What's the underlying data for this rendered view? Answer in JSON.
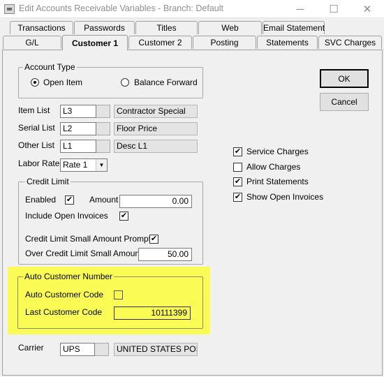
{
  "window": {
    "title": "Edit Accounts Receivable Variables  - Branch: Default",
    "minimize": "─",
    "maximize": "☐",
    "close": "✕"
  },
  "tabs": {
    "row_top": [
      "Transactions",
      "Passwords",
      "Titles",
      "Web",
      "Email Statement"
    ],
    "row_bottom": [
      "G/L",
      "Customer 1",
      "Customer 2",
      "Posting",
      "Statements",
      "SVC Charges"
    ],
    "active": "Customer 1"
  },
  "account_type": {
    "legend": "Account Type",
    "option_open_item": "Open Item",
    "option_balance_forward": "Balance Forward",
    "selected": "Open Item"
  },
  "lists": {
    "item_list": {
      "label": "Item List",
      "code": "L3",
      "desc": "Contractor Special"
    },
    "serial_list": {
      "label": "Serial List",
      "code": "L2",
      "desc": "Floor Price"
    },
    "other_list": {
      "label": "Other List",
      "code": "L1",
      "desc": "Desc L1"
    },
    "labor_rate": {
      "label": "Labor Rate",
      "value": "Rate 1",
      "arrow": "▼"
    }
  },
  "credit_limit": {
    "legend": "Credit Limit",
    "enabled_label": "Enabled",
    "enabled": true,
    "amount_label": "Amount",
    "amount": "0.00",
    "include_open_label": "Include Open Invoices",
    "include_open": true,
    "small_prompt_label": "Credit Limit Small Amount Prompt",
    "small_prompt": true,
    "over_small_label": "Over Credit Limit Small Amount",
    "over_small": "50.00"
  },
  "auto_customer": {
    "legend": "Auto Customer Number",
    "auto_code_label": "Auto Customer Code",
    "auto_code": false,
    "last_code_label": "Last Customer Code",
    "last_code": "10111399"
  },
  "carrier": {
    "label": "Carrier",
    "code": "UPS",
    "desc": "UNITED STATES POS"
  },
  "options": {
    "service_charges": {
      "label": "Service Charges",
      "checked": true
    },
    "allow_charges": {
      "label": "Allow Charges",
      "checked": false
    },
    "print_statements": {
      "label": "Print Statements",
      "checked": true
    },
    "show_open_invoices": {
      "label": "Show Open Invoices",
      "checked": true
    }
  },
  "buttons": {
    "ok": "OK",
    "cancel": "Cancel"
  },
  "check_glyph": "✔",
  "colors": {
    "highlight": "#fbfb56",
    "background": "#f0f0f0"
  }
}
